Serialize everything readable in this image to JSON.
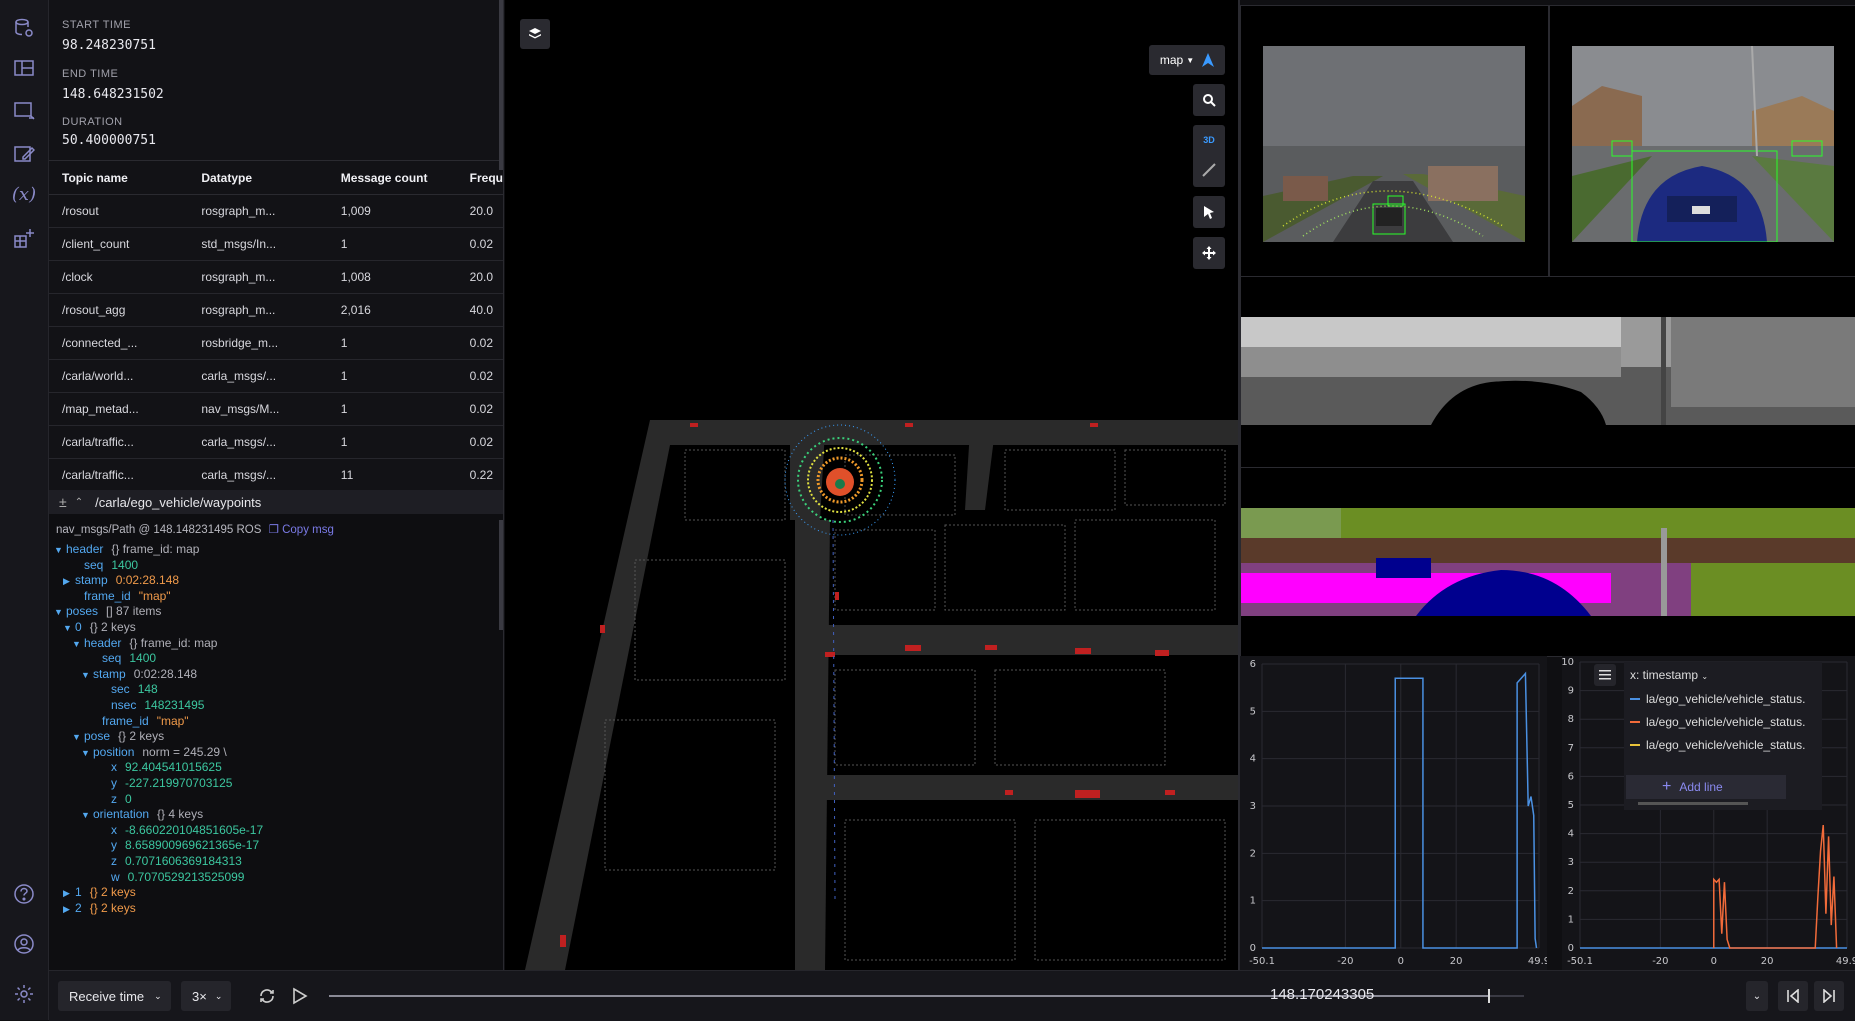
{
  "rail": {
    "icons": [
      "data-source-icon",
      "layout-icon",
      "add-panel-icon",
      "edit-panel-icon",
      "variables-icon",
      "extensions-icon",
      "help-icon",
      "account-icon",
      "settings-icon"
    ]
  },
  "info": {
    "start_label": "START TIME",
    "start_value": "98.248230751",
    "end_label": "END TIME",
    "end_value": "148.648231502",
    "duration_label": "DURATION",
    "duration_value": "50.400000751",
    "columns": [
      "Topic name",
      "Datatype",
      "Message count",
      "Frequ"
    ],
    "rows": [
      [
        "/rosout",
        "rosgraph_m...",
        "1,009",
        "20.0"
      ],
      [
        "/client_count",
        "std_msgs/In...",
        "1",
        "0.02"
      ],
      [
        "/clock",
        "rosgraph_m...",
        "1,008",
        "20.0"
      ],
      [
        "/rosout_agg",
        "rosgraph_m...",
        "2,016",
        "40.0"
      ],
      [
        "/connected_...",
        "rosbridge_m...",
        "1",
        "0.02"
      ],
      [
        "/carla/world...",
        "carla_msgs/...",
        "1",
        "0.02"
      ],
      [
        "/map_metad...",
        "nav_msgs/M...",
        "1",
        "0.02"
      ],
      [
        "/carla/traffic...",
        "carla_msgs/...",
        "1",
        "0.02"
      ],
      [
        "/carla/traffic...",
        "carla_msgs/...",
        "11",
        "0.22"
      ]
    ]
  },
  "raw": {
    "topic": "/carla/ego_vehicle/waypoints",
    "meta": "nav_msgs/Path @ 148.148231495 ROS",
    "copy_label": "Copy msg",
    "lines": [
      {
        "indent": 0,
        "arrow": "▼",
        "key": "header",
        "note": "{}  frame_id: map"
      },
      {
        "indent": 2,
        "arrow": "",
        "key": "seq",
        "num": "1400"
      },
      {
        "indent": 1,
        "arrow": "▶",
        "key": "stamp",
        "str": "0:02:28.148"
      },
      {
        "indent": 2,
        "arrow": "",
        "key": "frame_id",
        "str": "\"map\""
      },
      {
        "indent": 0,
        "arrow": "▼",
        "key": "poses",
        "note": "[]  87 items"
      },
      {
        "indent": 1,
        "arrow": "▼",
        "key": "0",
        "note": "{}  2 keys"
      },
      {
        "indent": 2,
        "arrow": "▼",
        "key": "header",
        "note": "{}  frame_id: map"
      },
      {
        "indent": 4,
        "arrow": "",
        "key": "seq",
        "num": "1400"
      },
      {
        "indent": 3,
        "arrow": "▼",
        "key": "stamp",
        "note": "0:02:28.148"
      },
      {
        "indent": 5,
        "arrow": "",
        "key": "sec",
        "num": "148"
      },
      {
        "indent": 5,
        "arrow": "",
        "key": "nsec",
        "num": "148231495"
      },
      {
        "indent": 4,
        "arrow": "",
        "key": "frame_id",
        "str": "\"map\""
      },
      {
        "indent": 2,
        "arrow": "▼",
        "key": "pose",
        "note": "{}  2 keys"
      },
      {
        "indent": 3,
        "arrow": "▼",
        "key": "position",
        "note": "norm = 245.29 \\"
      },
      {
        "indent": 5,
        "arrow": "",
        "key": "x",
        "num": "92.404541015625"
      },
      {
        "indent": 5,
        "arrow": "",
        "key": "y",
        "num": "-227.219970703125"
      },
      {
        "indent": 5,
        "arrow": "",
        "key": "z",
        "num": "0"
      },
      {
        "indent": 3,
        "arrow": "▼",
        "key": "orientation",
        "note": "{}  4 keys"
      },
      {
        "indent": 5,
        "arrow": "",
        "key": "x",
        "num": "-8.660220104851605e-17"
      },
      {
        "indent": 5,
        "arrow": "",
        "key": "y",
        "num": "8.658900969621365e-17"
      },
      {
        "indent": 5,
        "arrow": "",
        "key": "z",
        "num": "0.7071606369184313"
      },
      {
        "indent": 5,
        "arrow": "",
        "key": "w",
        "num": "0.7070529213525099"
      },
      {
        "indent": 1,
        "arrow": "▶",
        "key": "1",
        "orange": "{}  2 keys"
      },
      {
        "indent": 1,
        "arrow": "▶",
        "key": "2",
        "orange": "{}  2 keys"
      }
    ]
  },
  "three": {
    "frame_select": "map",
    "tools": [
      "layers-icon",
      "search-icon",
      "3d-toggle-icon",
      "ruler-icon",
      "select-icon",
      "move-icon"
    ],
    "mode_label": "3D"
  },
  "plot1": {
    "yticks": [
      "6",
      "5",
      "4",
      "3",
      "2",
      "1",
      "0"
    ],
    "xticks": [
      "-50.1",
      "-20",
      "0",
      "20",
      "49.9"
    ]
  },
  "plot2": {
    "yticks": [
      "10",
      "9",
      "8",
      "7",
      "6",
      "5",
      "4",
      "3",
      "2",
      "1",
      "0"
    ],
    "xticks": [
      "-50.1",
      "-20",
      "0",
      "20",
      "49.9"
    ],
    "x_axis_label": "x: timestamp",
    "lines": [
      {
        "label": "la/ego_vehicle/vehicle_status.",
        "color": "#4a90e2"
      },
      {
        "label": "la/ego_vehicle/vehicle_status.",
        "color": "#f26b3a"
      },
      {
        "label": "la/ego_vehicle/vehicle_status.",
        "color": "#e8c23a"
      }
    ],
    "add_line": "Add line"
  },
  "chart_data": [
    {
      "type": "line",
      "x": [
        -50.1,
        -20,
        0,
        20,
        49.9
      ],
      "ylim": [
        0,
        6
      ],
      "xlim": [
        -50.1,
        49.9
      ],
      "series": [
        {
          "values": [
            0,
            0,
            5.7,
            0,
            5.7
          ]
        }
      ],
      "grid": true
    },
    {
      "type": "line",
      "ylim": [
        0,
        10
      ],
      "xlim": [
        -50.1,
        49.9
      ],
      "series": [
        {
          "name": "la/ego_vehicle/vehicle_status.",
          "values": [
            0,
            0,
            0,
            0,
            0
          ]
        },
        {
          "name": "la/ego_vehicle/vehicle_status.",
          "values": [
            0,
            0,
            2.4,
            0,
            4.2
          ]
        },
        {
          "name": "la/ego_vehicle/vehicle_status.",
          "values": [
            0,
            0,
            0,
            0,
            0
          ]
        }
      ],
      "grid": true
    }
  ],
  "bottom": {
    "receive_label": "Receive time",
    "speed": "3×",
    "time": "148.170243305",
    "progress": 0.97
  },
  "colors": {
    "accent": "#6f6fd8",
    "background": "#0f0f12",
    "series_blue": "#4a90e2",
    "series_orange": "#f26b3a"
  }
}
